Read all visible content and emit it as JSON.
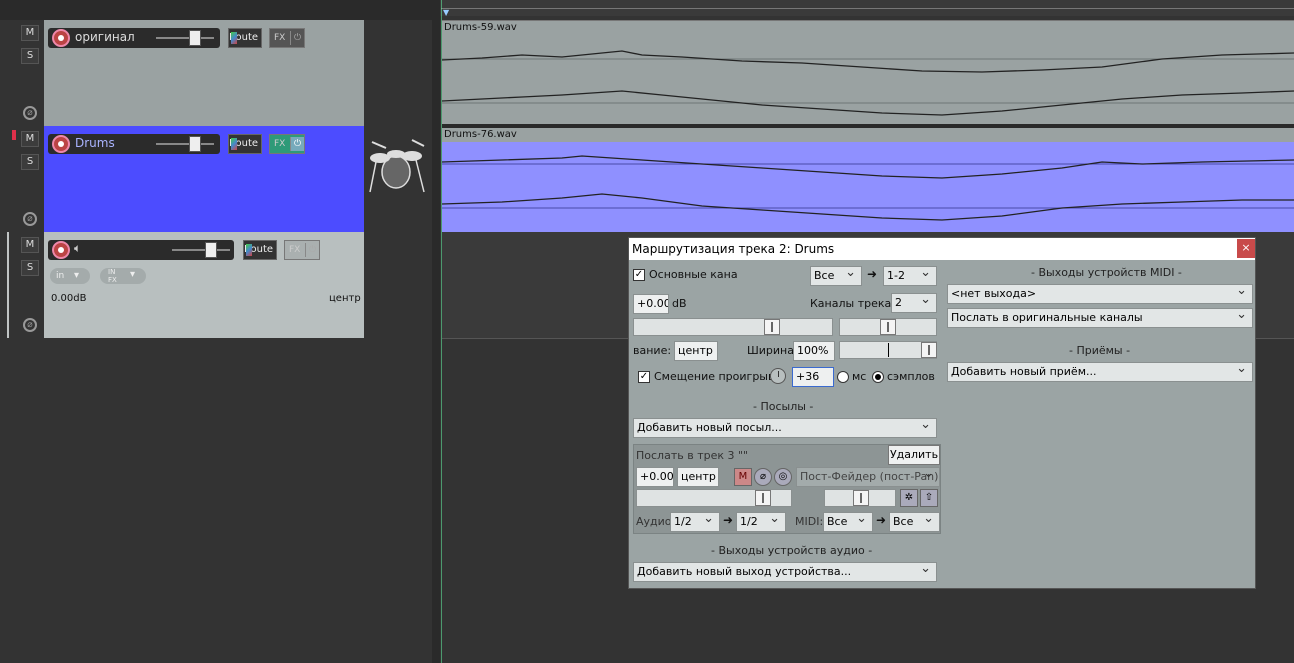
{
  "tracks": [
    {
      "name": "оригинал",
      "mute": "M",
      "solo": "S",
      "route": "Route",
      "fx": "FX"
    },
    {
      "name": "Drums",
      "mute": "M",
      "solo": "S",
      "route": "Route",
      "fx": "FX"
    },
    {
      "name": "",
      "mute": "M",
      "solo": "S",
      "route": "Route",
      "fx": "FX",
      "in_label": "in",
      "infx_label": "IN FX",
      "volume": "0.00dB",
      "pan": "центр"
    }
  ],
  "items": [
    {
      "label": "Drums-59.wav"
    },
    {
      "label": "Drums-76.wav"
    }
  ],
  "dialog": {
    "title": "Маршрутизация трека 2: Drums",
    "close": "×",
    "master_send_label": "Основные кана",
    "master_send_checked": true,
    "channels_select": "Все",
    "channels_dest": "1-2",
    "volume": "+0.00",
    "volume_unit": "dB",
    "track_channels_label": "Каналы трека:",
    "track_channels_value": "2",
    "pan_label": "вание:",
    "pan_value": "центр",
    "width_label": "Ширина:",
    "width_value": "100%",
    "offset_label": "Смещение проигрыва",
    "offset_checked": true,
    "offset_value": "+36",
    "unit_ms": "мс",
    "unit_samples": "сэмплов",
    "sends_title": "-  Посылы  -",
    "add_send": "Добавить новый посыл...",
    "send": {
      "title": "Послать в трек 3 \"\"",
      "delete": "Удалить",
      "volume": "+0.00",
      "pan": "центр",
      "mute": "M",
      "mode": "Пост-Фейдер (пост-Pan)",
      "audio_label": "Аудио:",
      "audio_src": "1/2",
      "audio_dst": "1/2",
      "midi_label": "MIDI:",
      "midi_src": "Все",
      "midi_dst": "Все"
    },
    "hw_out_title": "-  Выходы устройств аудио  -",
    "add_hw_out": "Добавить новый выход устройства...",
    "midi_out_title": "-  Выходы устройств MIDI  -",
    "midi_out_value": "<нет выхода>",
    "midi_out_mode": "Послать в оригинальные каналы",
    "receives_title": "-  Приёмы  -",
    "add_receive": "Добавить новый приём..."
  },
  "colors": {
    "selected_track": "#4c4cff",
    "item_selected": "#8f90ff",
    "item_normal": "#9aa2a2"
  }
}
